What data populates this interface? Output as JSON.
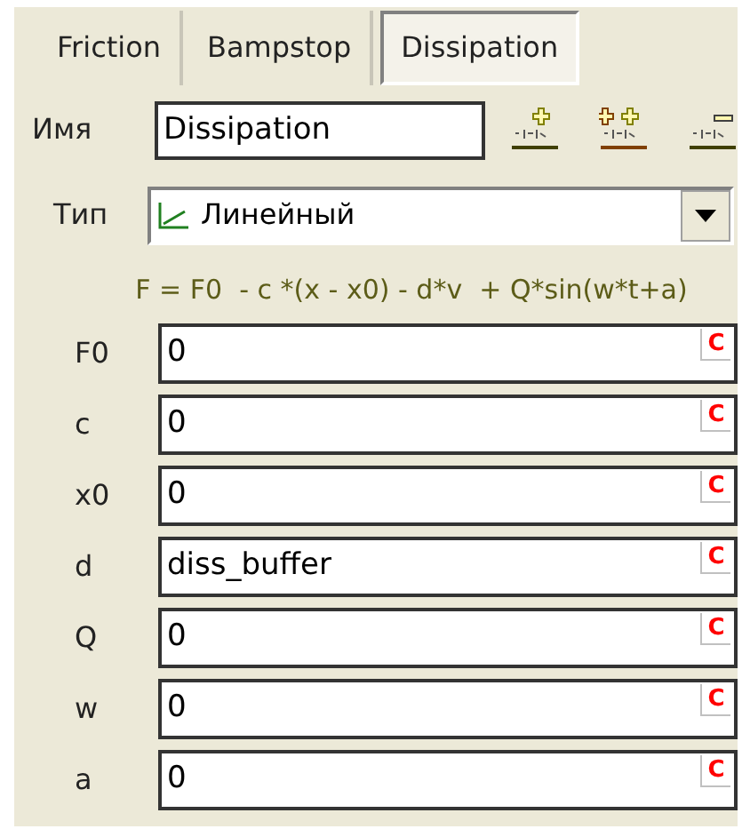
{
  "tabs": [
    {
      "label": "Friction",
      "selected": false
    },
    {
      "label": "Bampstop",
      "selected": false
    },
    {
      "label": "Dissipation",
      "selected": true
    }
  ],
  "name": {
    "label": "Имя",
    "value": "Dissipation"
  },
  "type": {
    "label": "Тип",
    "value": "Линейный"
  },
  "formula": "F = F0  - c *(x - x0) - d*v  + Q*sin(w*t+a)",
  "params": [
    {
      "label": "F0",
      "value": "0",
      "button": "C"
    },
    {
      "label": "c",
      "value": "0",
      "button": "C"
    },
    {
      "label": "x0",
      "value": "0",
      "button": "C"
    },
    {
      "label": "d",
      "value": "diss_buffer",
      "button": "C"
    },
    {
      "label": "Q",
      "value": "0",
      "button": "C"
    },
    {
      "label": "w",
      "value": "0",
      "button": "C"
    },
    {
      "label": "a",
      "value": "0",
      "button": "C"
    }
  ]
}
